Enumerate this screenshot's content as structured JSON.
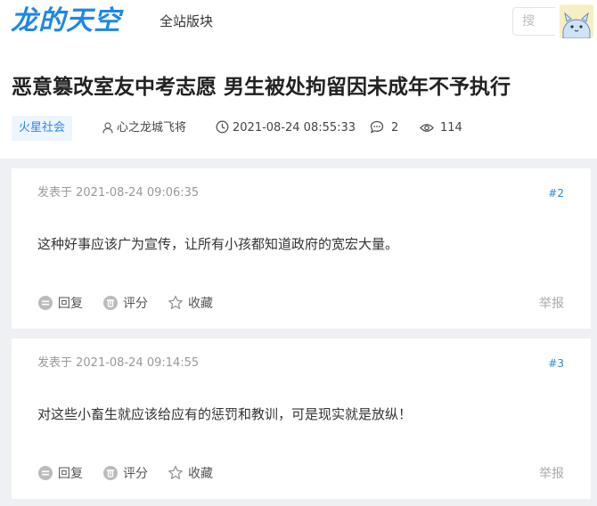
{
  "header": {
    "logo": "龙的天空",
    "nav": "全站版块",
    "search_placeholder": "搜"
  },
  "thread": {
    "title": "恶意篡改室友中考志愿 男生被处拘留因未成年不予执行",
    "tag": "火星社会",
    "author": "心之龙城飞将",
    "datetime": "2021-08-24 08:55:33",
    "replies": "2",
    "views": "114"
  },
  "colors": {
    "accent": "#2d86e6",
    "logo": "#1e88e5",
    "background_gray": "#eef0f3"
  },
  "posts": [
    {
      "time": "发表于 2021-08-24 09:06:35",
      "floor": "#2",
      "content": "这种好事应该广为宣传，让所有小孩都知道政府的宽宏大量。",
      "reply": "回复",
      "rate": "评分",
      "favorite": "收藏",
      "report": "举报"
    },
    {
      "time": "发表于 2021-08-24 09:14:55",
      "floor": "#3",
      "content": "对这些小畜生就应该给应有的惩罚和教训，可是现实就是放纵！",
      "reply": "回复",
      "rate": "评分",
      "favorite": "收藏",
      "report": "举报"
    }
  ]
}
